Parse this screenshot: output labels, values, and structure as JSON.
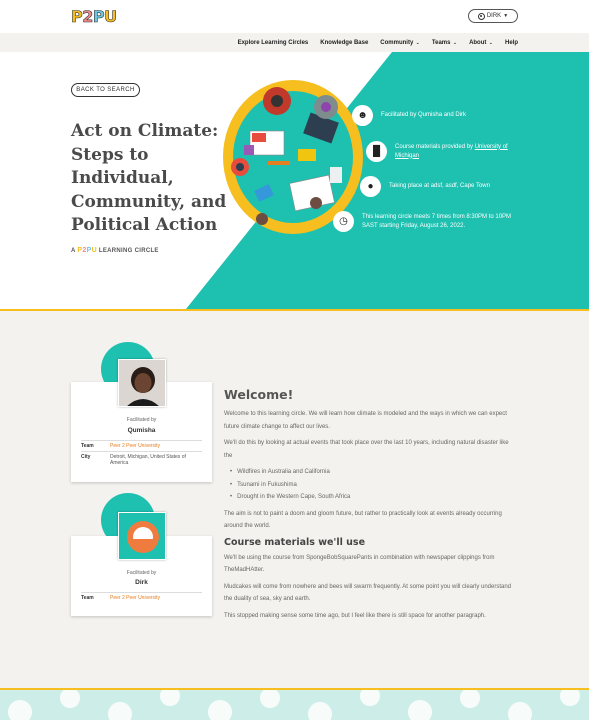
{
  "header": {
    "logo_text": "P2PU",
    "logo_colors": [
      "#f6be1e",
      "#f08a8a",
      "#6fc7e0",
      "#f6be1e"
    ],
    "user_label": "DIRK"
  },
  "nav": {
    "items": [
      {
        "label": "Explore Learning Circles",
        "dropdown": false
      },
      {
        "label": "Knowledge Base",
        "dropdown": false
      },
      {
        "label": "Community",
        "dropdown": true
      },
      {
        "label": "Teams",
        "dropdown": true
      },
      {
        "label": "About",
        "dropdown": true
      },
      {
        "label": "Help",
        "dropdown": false
      }
    ]
  },
  "hero": {
    "back_label": "BACK TO SEARCH",
    "title": "Act on Climate: Steps to Individual, Community, and Political Action",
    "subtitle_prefix": "A",
    "subtitle_logo": "P2PU",
    "subtitle_suffix": "LEARNING CIRCLE",
    "facilitated": "Facilitated by Qumisha and Dirk",
    "materials_prefix": "Course materials provided by ",
    "materials_link": "University of Michigan",
    "location": "Taking place at adsf, asdf, Cape Town",
    "schedule": "This learning circle meets 7 times from 8:30PM to 10PM SAST starting Friday, August 26, 2022."
  },
  "facilitators": [
    {
      "label": "Facilitated by",
      "name": "Qumisha",
      "team_key": "Team",
      "team_value": "Peer 2 Peer University",
      "city_key": "City",
      "city_value": "Detroit, Michigan, United States of America"
    },
    {
      "label": "Facilitated by",
      "name": "Dirk",
      "team_key": "Team",
      "team_value": "Peer 2 Peer University"
    }
  ],
  "content": {
    "welcome_title": "Welcome!",
    "p1": "Welcome to this learning circle. We will learn how climate is modeled and the ways in which we can expect future climate change to affect our lives.",
    "p2": "We'll do this by looking at actual events that took place over the last 10 years, including natural disaster like the",
    "bullets": [
      "Wildfires in Australia and California",
      "Tsunami in Fukushima",
      "Drought in the Western Cape, South Africa"
    ],
    "p3": "The aim is not to paint a doom and gloom future, but rather to practically look at events already occurring around the world.",
    "materials_title": "Course materials we'll use",
    "p4": "We'll be using the course from SpongeBobSquarePants in combination with newspaper clippings from TheMadHAtter.",
    "p5": "Mudcakes will come from nowhere and bees will swarm frequently. At some point you will clearly understand the duality of sea, sky and earth.",
    "p6": "This stopped making sense some time ago, but I feel like there is still space for another paragraph."
  },
  "colors": {
    "teal": "#1ec0b0",
    "yellow": "#f6be1e",
    "link_orange": "#e67e22",
    "section_bg": "#f3f2ee"
  }
}
